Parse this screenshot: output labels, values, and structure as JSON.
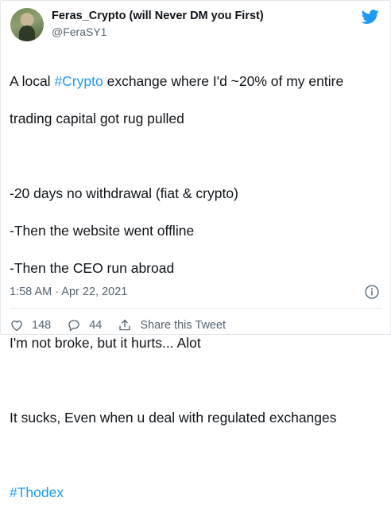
{
  "author": {
    "display_name": "Feras_Crypto (will Never DM you First)",
    "handle": "@FeraSY1"
  },
  "tweet": {
    "line1_prefix": "A local ",
    "line1_hashtag": "#Crypto",
    "line1_suffix": " exchange where I'd ~20% of my entire",
    "line2": "trading capital got rug pulled",
    "line3": "-20 days no withdrawal (fiat & crypto)",
    "line4": "-Then the website went offline",
    "line5": "-Then the CEO run abroad",
    "line6": "I'm not broke, but it hurts... Alot",
    "line7": "It sucks, Even when u deal with regulated exchanges",
    "hashtag_line": "#Thodex"
  },
  "timestamp": "1:58 AM · Apr 22, 2021",
  "actions": {
    "like_count": "148",
    "reply_count": "44",
    "share_label": "Share this Tweet"
  },
  "colors": {
    "accent": "#1d9bf0",
    "muted": "#536471",
    "text": "#0f1419"
  },
  "icons": {
    "logo": "twitter-bird-icon",
    "info": "info-icon",
    "like": "heart-icon",
    "reply": "reply-icon",
    "share": "share-icon"
  }
}
